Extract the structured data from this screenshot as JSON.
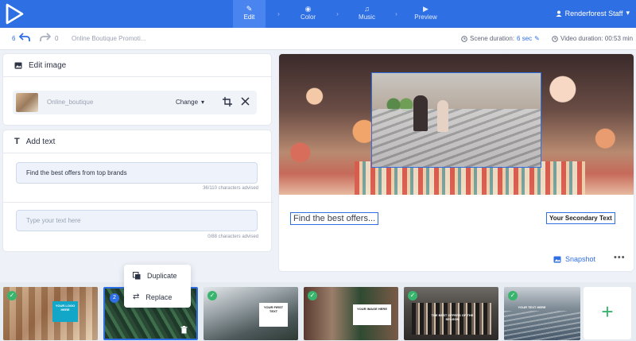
{
  "topbar": {
    "steps": [
      {
        "label": "Edit",
        "icon": "pencil-icon",
        "active": true
      },
      {
        "label": "Color",
        "icon": "palette-icon",
        "active": false
      },
      {
        "label": "Music",
        "icon": "music-note-icon",
        "active": false
      },
      {
        "label": "Preview",
        "icon": "play-icon",
        "active": false
      }
    ],
    "user_name": "Renderforest Staff",
    "brand_color": "#2f6fe4"
  },
  "subbar": {
    "undo_count": "6",
    "redo_count": "0",
    "project_title": "Online Boutique Promoti...",
    "scene_duration_label": "Scene duration:",
    "scene_duration_value": "6 sec",
    "video_duration_label": "Video duration: 00:53 min"
  },
  "edit_image": {
    "title": "Edit image",
    "image_name": "Online_boutique",
    "change_label": "Change"
  },
  "add_text": {
    "title": "Add text",
    "field1_value": "Find the best offers from top brands",
    "field1_hint": "36/110 characters advised",
    "field2_placeholder": "Type your text here",
    "field2_hint": "0/88 characters advised"
  },
  "preview": {
    "text1": "Find the best offers...",
    "text2": "Your Secondary Text",
    "snapshot_label": "Snapshot"
  },
  "context_menu": {
    "duplicate": "Duplicate",
    "replace": "Replace"
  },
  "timeline": {
    "selected_scene_number": "2",
    "scenes": [
      {
        "card": "YOUR LOGO HERE"
      },
      {
        "card": ""
      },
      {
        "card": "YOUR FIRST TEXT"
      },
      {
        "card": "YOUR IMAGE HERE"
      },
      {
        "card": "THE BEST OFFERS OF THE SEASON"
      },
      {
        "card": "YOUR TEXT HERE"
      }
    ],
    "add_label": "+"
  }
}
